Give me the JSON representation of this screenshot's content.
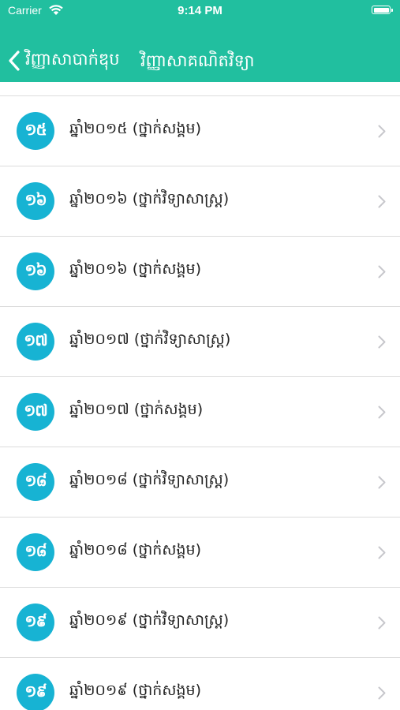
{
  "status_bar": {
    "carrier": "Carrier",
    "time": "9:14 PM"
  },
  "nav": {
    "back_label": "វិញ្ញាសាបាក់ឌុប",
    "title": "វិញ្ញាសាគណិតវិទ្យា"
  },
  "items": [
    {
      "badge": "១៥",
      "label": "ឆ្នាំ២០១៥ (ថ្នាក់សង្គម)"
    },
    {
      "badge": "១៦",
      "label": "ឆ្នាំ២០១៦ (ថ្នាក់វិទ្យាសាស្រ្ត)"
    },
    {
      "badge": "១៦",
      "label": "ឆ្នាំ២០១៦ (ថ្នាក់សង្គម)"
    },
    {
      "badge": "១៧",
      "label": "ឆ្នាំ២០១៧ (ថ្នាក់វិទ្យាសាស្រ្ត)"
    },
    {
      "badge": "១៧",
      "label": "ឆ្នាំ២០១៧ (ថ្នាក់សង្គម)"
    },
    {
      "badge": "១៨",
      "label": "ឆ្នាំ២០១៨ (ថ្នាក់វិទ្យាសាស្រ្ត)"
    },
    {
      "badge": "១៨",
      "label": "ឆ្នាំ២០១៨ (ថ្នាក់សង្គម)"
    },
    {
      "badge": "១៩",
      "label": "ឆ្នាំ២០១៩ (ថ្នាក់វិទ្យាសាស្រ្ត)"
    },
    {
      "badge": "១៩",
      "label": "ឆ្នាំ២០១៩ (ថ្នាក់សង្គម)"
    }
  ],
  "colors": {
    "header": "#21bf9f",
    "badge": "#17b3d3",
    "chevron": "#c7c7cc"
  },
  "icons": {
    "back": "chevron-left-icon",
    "disclosure": "chevron-right-icon",
    "wifi": "wifi-icon",
    "battery": "battery-icon"
  }
}
